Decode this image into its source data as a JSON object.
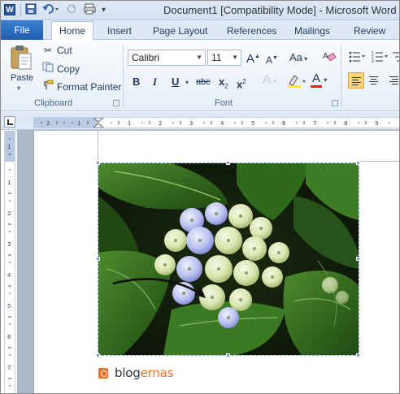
{
  "window": {
    "title": "Document1 [Compatibility Mode] - Microsoft Word",
    "app_icon": "W"
  },
  "quick_access": {
    "icons": [
      "save-icon",
      "undo-icon",
      "redo-icon",
      "print-preview-icon",
      "customize-qat-icon"
    ]
  },
  "tabs": {
    "file": "File",
    "items": [
      {
        "label": "Home",
        "active": true
      },
      {
        "label": "Insert"
      },
      {
        "label": "Page Layout"
      },
      {
        "label": "References"
      },
      {
        "label": "Mailings"
      },
      {
        "label": "Review"
      }
    ]
  },
  "clipboard": {
    "paste_label": "Paste",
    "cut_label": "Cut",
    "copy_label": "Copy",
    "format_painter_label": "Format Painter",
    "group_label": "Clipboard"
  },
  "font": {
    "family": "Calibri",
    "size": "11",
    "grow": "A",
    "shrink": "A",
    "change_case": "Aa",
    "bold": "B",
    "italic": "I",
    "underline": "U",
    "strike": "abc",
    "subscript": "x",
    "superscript": "x",
    "text_effects": "A",
    "font_color": "A",
    "group_label": "Font"
  },
  "document": {
    "image_alt": "hydrangea photo with arrow",
    "arrow_color": "#111111"
  },
  "watermark": {
    "prefix": "blog",
    "suffix": "ernas"
  },
  "colors": {
    "file_tab": "#2b6bc2",
    "accent_orange": "#f26f21",
    "ribbon_bg": "#e6eef8"
  }
}
